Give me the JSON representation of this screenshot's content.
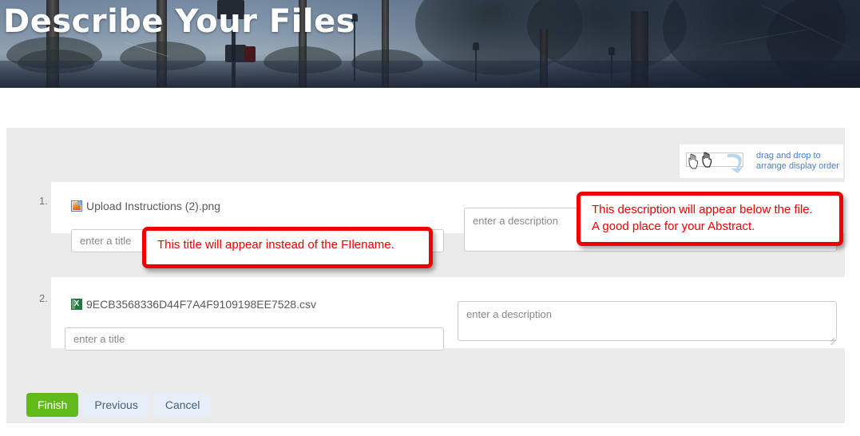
{
  "banner": {
    "title": "Describe Your Files",
    "image_description": "palm trees and street scene photo banner"
  },
  "drag_hint": {
    "line1": "drag and drop to",
    "line2": "arrange display order",
    "icon": "drag-hand-icon",
    "color": "#4a7fd0"
  },
  "files": [
    {
      "number": "1.",
      "icon": "png-file-icon",
      "filename": "Upload Instructions (2).png",
      "title_placeholder": "enter a title",
      "title_value": "",
      "description_placeholder": "enter a description",
      "description_value": ""
    },
    {
      "number": "2.",
      "icon": "csv-file-icon",
      "filename": "9ECB3568336D44F7A4F9109198EE7528.csv",
      "title_placeholder": "enter a title",
      "title_value": "",
      "description_placeholder": "enter a description",
      "description_value": ""
    }
  ],
  "callouts": [
    {
      "id": "title-callout",
      "line1": "This title will appear instead of the FIlename.",
      "line2": "",
      "color": "#ee0000"
    },
    {
      "id": "description-callout",
      "line1": "This description will appear below the file.",
      "line2": "A good place for your Abstract.",
      "color": "#ee0000"
    }
  ],
  "buttons": {
    "finish": "Finish",
    "previous": "Previous",
    "cancel": "Cancel",
    "finish_color": "#62b91a",
    "secondary_color": "#e8eef8"
  }
}
